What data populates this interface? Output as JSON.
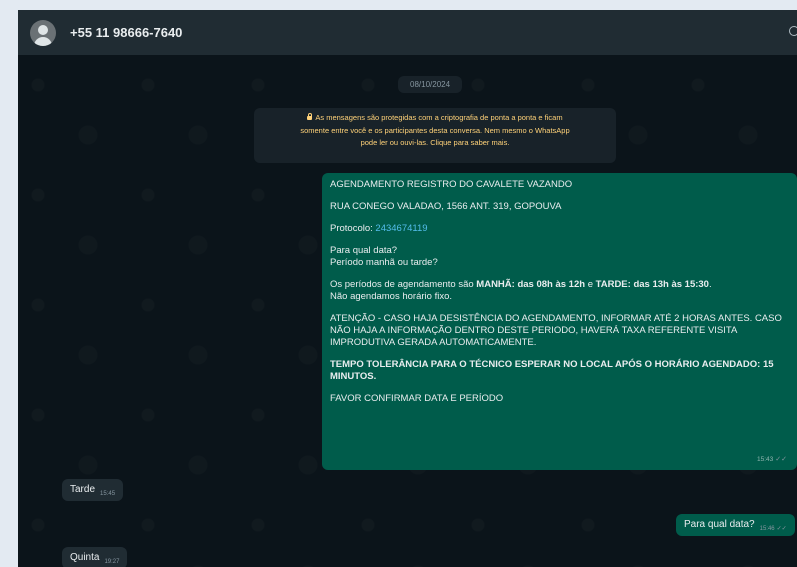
{
  "header": {
    "contact": "+55 11 98666-7640"
  },
  "chat": {
    "date": "08/10/2024",
    "encryption_notice": {
      "line1": "As mensagens são protegidas com a criptografia de ponta a ponta e ficam",
      "line2": "somente entre você e os participantes desta conversa. Nem mesmo o WhatsApp",
      "line3": "pode ler ou ouvi-las. Clique para saber mais."
    },
    "message1": {
      "title": "AGENDAMENTO REGISTRO DO CAVALETE VAZANDO",
      "address": "RUA CONEGO VALADAO, 1566 ANT. 319, GOPOUVA",
      "protocol_label": "Protocolo: ",
      "protocol_number": "2434674119",
      "question1": "Para qual data?",
      "question2": "Período manhã ou tarde?",
      "periods_prefix": "Os períodos de agendamento são ",
      "periods_morning": "MANHÃ: das 08h às 12h",
      "periods_mid": " e ",
      "periods_afternoon": "TARDE: das 13h às 15:30",
      "periods_end": ".",
      "no_fixed": "Não agendamos horário fixo.",
      "attention": "ATENÇÃO - CASO HAJA DESISTÊNCIA DO AGENDAMENTO, INFORMAR ATÉ 2 HORAS ANTES. CASO NÃO HAJA A INFORMAÇÃO DENTRO DESTE PERIODO, HAVERÁ TAXA REFERENTE VISITA IMPRODUTIVA GERADA AUTOMATICAMENTE.",
      "tolerance": "TEMPO TOLERÂNCIA PARA O TÉCNICO ESPERAR NO LOCAL APÓS O HORÁRIO AGENDADO: 15 MINUTOS.",
      "confirm": "FAVOR CONFIRMAR DATA E PERÍODO",
      "time": "15:43"
    },
    "message2": {
      "text": "Tarde",
      "time": "15:45"
    },
    "message3": {
      "text": "Para qual data?",
      "time": "15:46"
    },
    "message4": {
      "text": "Quinta",
      "time": "19:27"
    }
  },
  "icons": {
    "ticks": "✓✓"
  },
  "colors": {
    "outgoing_bubble": "#005c4b",
    "incoming_bubble": "#202c33",
    "link": "#53bdeb",
    "notice_text": "#ffd279"
  }
}
